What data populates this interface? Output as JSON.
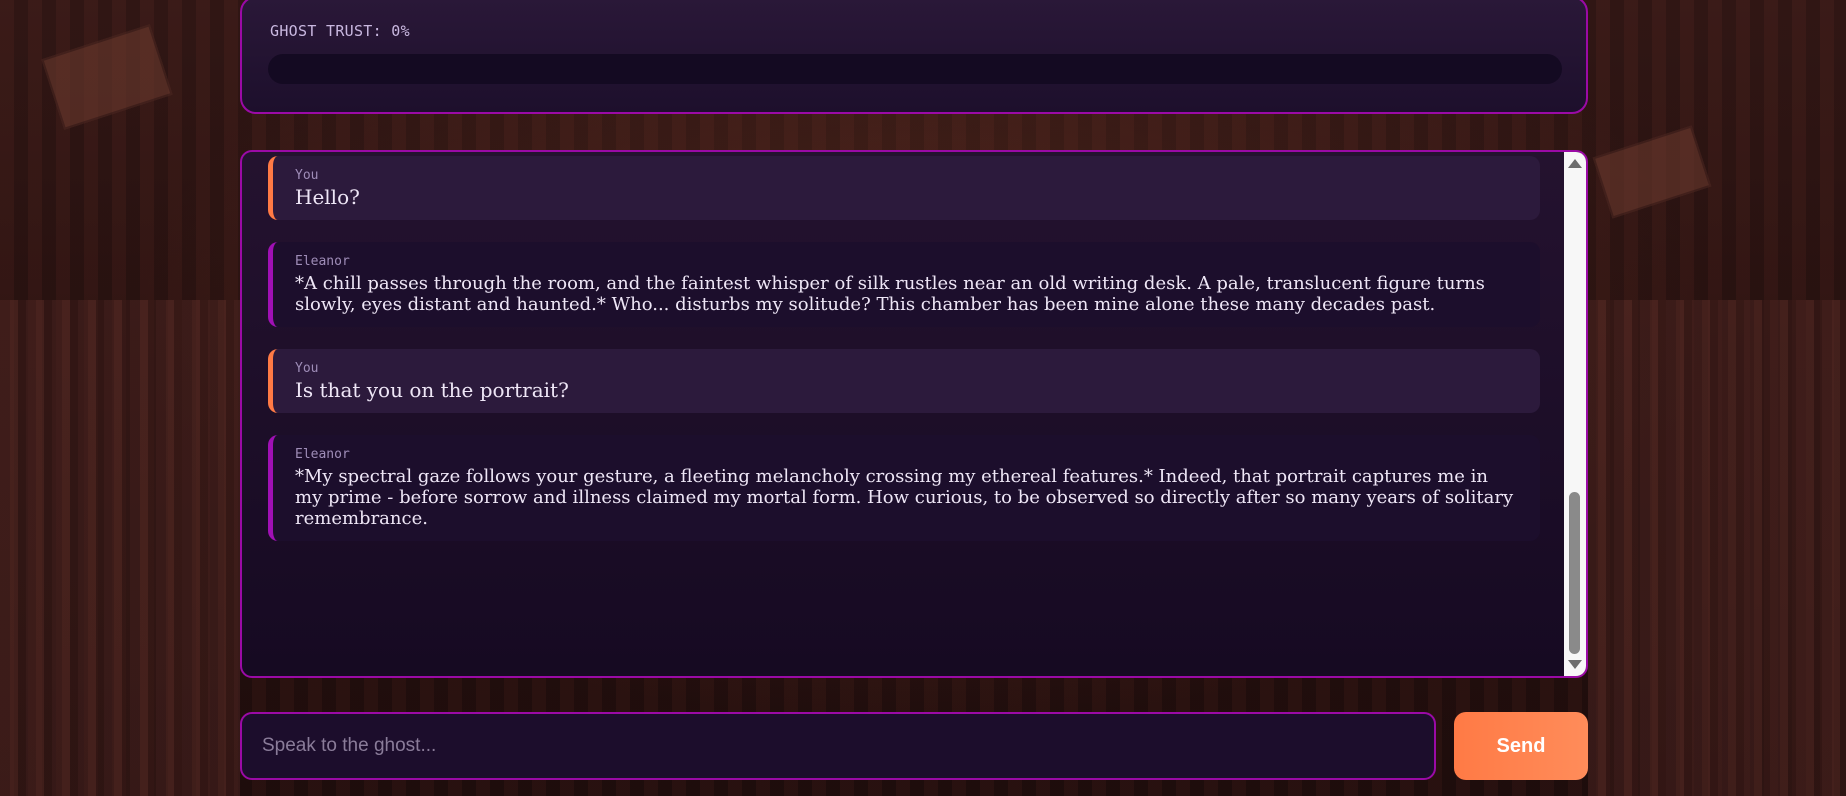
{
  "trust": {
    "label": "GHOST TRUST: 0%",
    "value_percent": 0
  },
  "chat": {
    "messages": [
      {
        "sender": "You",
        "text": "Hello?"
      },
      {
        "sender": "Eleanor",
        "text": "*A chill passes through the room, and the faintest whisper of silk rustles near an old writing desk. A pale, translucent figure turns slowly, eyes distant and haunted.* Who... disturbs my solitude? This chamber has been mine alone these many decades past."
      },
      {
        "sender": "You",
        "text": "Is that you on the portrait?"
      },
      {
        "sender": "Eleanor",
        "text": "*My spectral gaze follows your gesture, a fleeting melancholy crossing my ethereal features.* Indeed, that portrait captures me in my prime - before sorrow and illness claimed my mortal form. How curious, to be observed so directly after so many years of solitary remembrance."
      }
    ]
  },
  "input": {
    "placeholder": "Speak to the ghost...",
    "value": ""
  },
  "send_button": {
    "label": "Send"
  },
  "colors": {
    "accent_orange": "#ff7a45",
    "accent_purple": "#9b0aa6",
    "panel_bg": "#1c0e2c"
  }
}
